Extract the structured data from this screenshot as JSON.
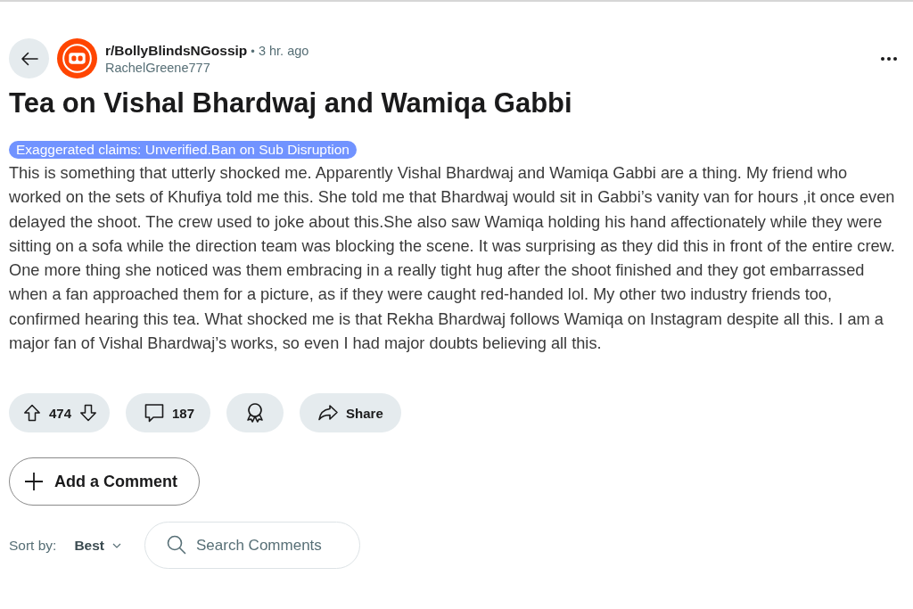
{
  "post": {
    "subreddit": "r/BollyBlindsNGossip",
    "separator": "•",
    "time": "3 hr. ago",
    "author": "RachelGreene777",
    "title": "Tea on Vishal Bhardwaj and Wamiqa Gabbi",
    "flair": "Exaggerated claims: Unverified.Ban on Sub Disruption",
    "body": "This is something that utterly shocked me. Apparently Vishal Bhardwaj and Wamiqa Gabbi are a thing. My friend who worked on the sets of Khufiya told me this. She told me that Bhardwaj would sit in Gabbi’s vanity van for hours ,it once even delayed the shoot. The crew used to joke about this.She also saw Wamiqa holding his hand affectionately while they were sitting on a sofa while the direction team was blocking the scene. It was surprising as they did this in front of the entire crew. One more thing she noticed was them embracing in a really tight hug after the shoot finished and they got embarrassed when a fan approached them for a picture, as if they were caught red-handed lol. My other two industry friends too, confirmed hearing this tea. What shocked me is that Rekha Bhardwaj follows Wamiqa on Instagram despite all this. I am a major fan of Vishal Bhardwaj’s works, so even I had major doubts believing all this."
  },
  "actions": {
    "score": "474",
    "comments": "187",
    "share": "Share"
  },
  "add_comment": "Add a Comment",
  "sort": {
    "label": "Sort by:",
    "value": "Best"
  },
  "search": {
    "placeholder": "Search Comments"
  }
}
